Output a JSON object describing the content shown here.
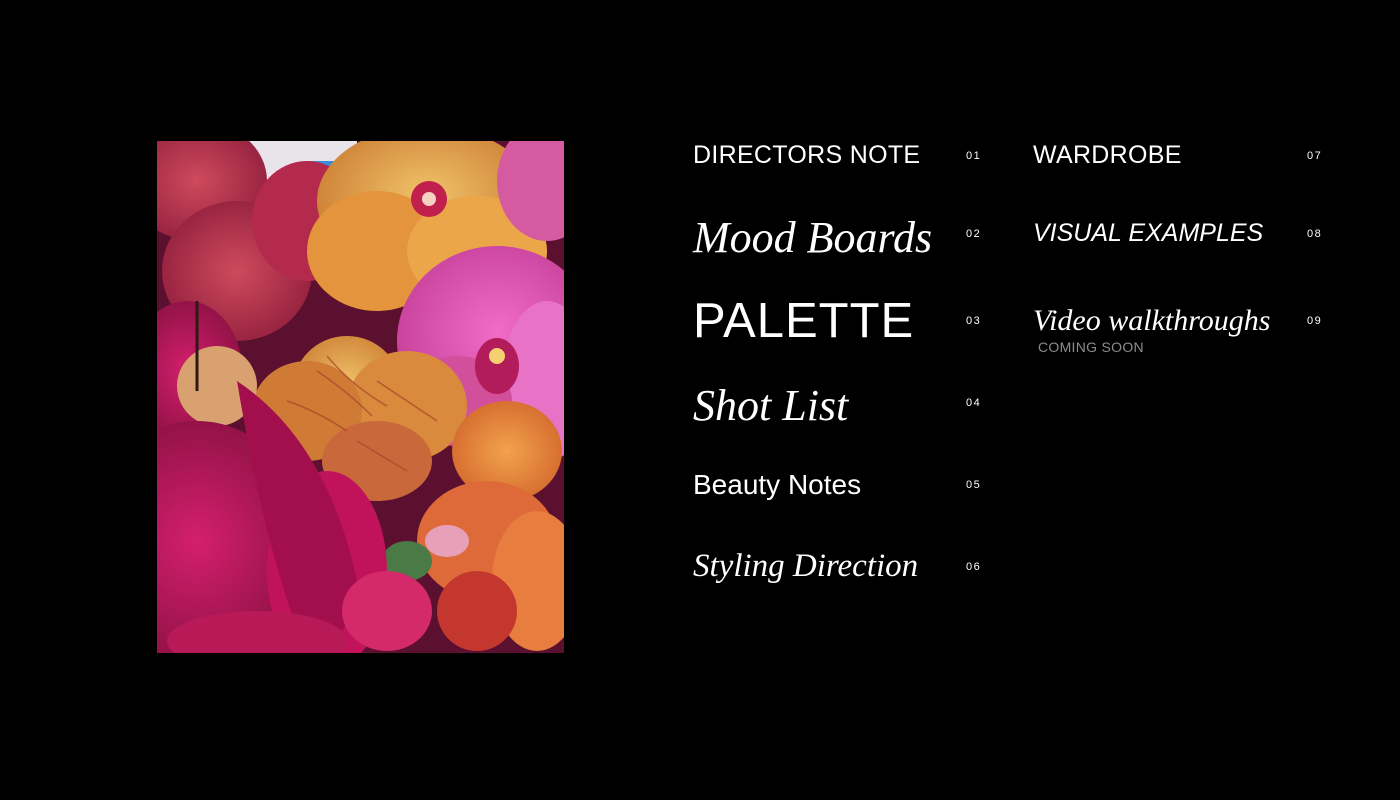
{
  "photo": {
    "alt": "Orchid flowers",
    "colors": {
      "magenta": "#c0135e",
      "pink": "#e85bb8",
      "orange": "#e8863c",
      "gold": "#e9a94a",
      "deep": "#6a0c35"
    }
  },
  "menu": {
    "items": [
      {
        "label": "DIRECTORS NOTE",
        "number": "01"
      },
      {
        "label": "Mood Boards",
        "number": "02"
      },
      {
        "label": "PALETTE",
        "number": "03"
      },
      {
        "label": "Shot List",
        "number": "04"
      },
      {
        "label": "Beauty Notes",
        "number": "05"
      },
      {
        "label": "Styling Direction",
        "number": "06"
      },
      {
        "label": "WARDROBE",
        "number": "07"
      },
      {
        "label": "VISUAL EXAMPLES",
        "number": "08"
      },
      {
        "label": "Video walkthroughs",
        "number": "09",
        "note": "COMING SOON"
      }
    ]
  }
}
